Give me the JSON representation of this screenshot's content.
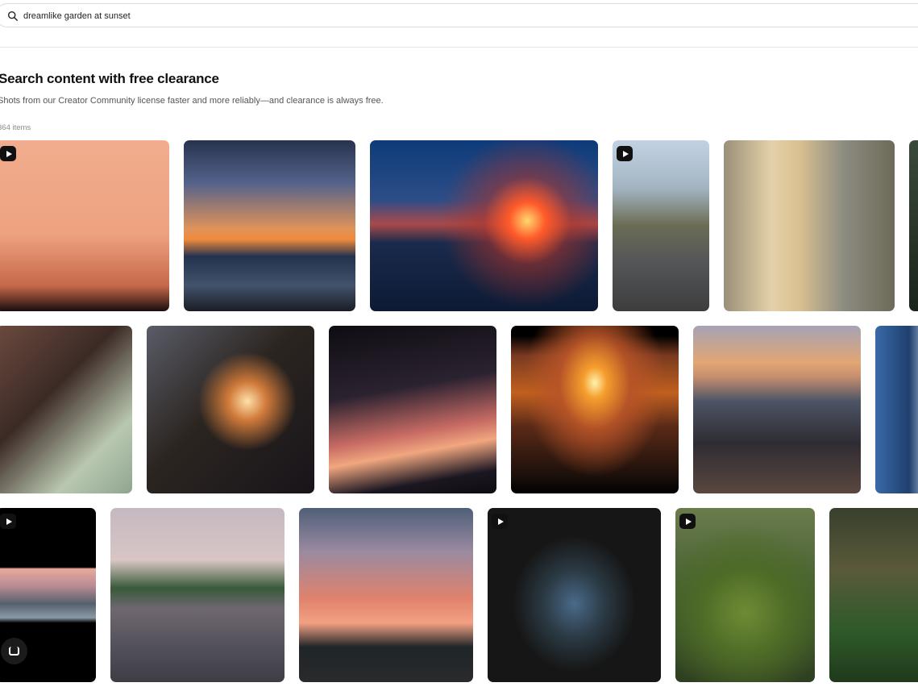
{
  "search": {
    "query": "dreamlike garden at sunset",
    "icon": "search-icon"
  },
  "page": {
    "heading": "Search content with free clearance",
    "subheading": "Shots from our Creator Community license faster and more reliably—and clearance is always free.",
    "count": "364 items"
  },
  "colors": {
    "accent": "#111111",
    "border": "#dcdcdc",
    "muted": "#8a8a8a"
  },
  "tiles": [
    {
      "name": "tile-pink-sky",
      "video": true,
      "bg": "linear-gradient(180deg,#f1ad8e 0%,#eda27f 55%,#c7684a 85%,#1a0e0e 100%)"
    },
    {
      "name": "tile-beach-sunset",
      "video": false,
      "bg": "linear-gradient(180deg,#27334e 0%,#54628a 25%,#e1935a 52%,#f08a3a 58%,#23324e 68%,#42536b 85%,#1a1d25 100%)"
    },
    {
      "name": "tile-airplane-sunset",
      "video": false,
      "bg": "radial-gradient(circle at 69% 47%, #ffd86e 0%, #ff5a2a 10%, rgba(173,52,42,0.55) 24%, rgba(12,39,96,0) 48%), linear-gradient(180deg,#0d3b7a 0%,#2d4d87 35%,#a84a4a 49%,#1a2a4c 60%,#0c1a34 100%)"
    },
    {
      "name": "tile-child-street",
      "video": true,
      "bg": "linear-gradient(180deg,#c2d2e4 0%,#a3b4c1 28%,#6b6c54 50%,#555759 70%,#3d3d3d 100%)"
    },
    {
      "name": "tile-blonde-marina",
      "video": false,
      "bg": "linear-gradient(90deg,#9a8f79 0%,#e5d1a9 28%,#d7bf90 45%,#8d8c81 70%,#6d6a58 100%)"
    },
    {
      "name": "tile-partial-right-1",
      "video": false,
      "bg": "linear-gradient(180deg,#3a4a3a,#1b241b)"
    },
    {
      "name": "tile-portrait-woman",
      "video": false,
      "bg": "linear-gradient(135deg,#6b4a3e 0%,#3c2a26 40%,#b9c8b0 75%,#8fa590 100%)"
    },
    {
      "name": "tile-street-sunflare",
      "video": false,
      "bg": "radial-gradient(circle at 60% 45%, #ffe0a8 0%, #d07a3a 14%, rgba(60,40,30,0) 36%), linear-gradient(135deg,#5a5c68 0%,#2b2520 45%,#18141a 100%)"
    },
    {
      "name": "tile-palm-silhouette",
      "video": false,
      "bg": "linear-gradient(170deg,#0e0d12 0%,#2b2230 38%,#c86b64 62%,#f1a77f 72%,#1b1722 88%,#0d0c10 100%)"
    },
    {
      "name": "tile-mountain-sunset",
      "video": false,
      "bg": "radial-gradient(ellipse at 50% 34%, #fff2b0 0%, #f59e2d 10%, rgba(184,84,40,0.9) 30%, rgba(0,0,0,0) 60%), linear-gradient(180deg,#000 0%,#000 6%,#7a3a20 18%,#c0601e 40%,#5a2a18 60%,#1a0f0a 90%,#000 100%)"
    },
    {
      "name": "tile-couple-pier",
      "video": false,
      "bg": "linear-gradient(180deg,#a6a3b5 0%,#e1a673 22%,#c9906f 30%,#4d5466 45%,#2f2c33 70%,#5a473f 100%)"
    },
    {
      "name": "tile-partial-right-2",
      "video": false,
      "bg": "linear-gradient(90deg,#3a6aa8 0%,#1f3f6e 60%,#c8d6ea 100%)"
    },
    {
      "name": "tile-parking-sunset",
      "video": true,
      "bg": "linear-gradient(180deg,#000 0%,#000 34%,#e8a99d 35%,#b88b94 45%,#55606b 55%,#8a9aa8 63%,#000 66%,#000 100%)"
    },
    {
      "name": "tile-wine-waterway",
      "video": false,
      "bg": "linear-gradient(180deg,#c6b8c2 0%,#d8c6c4 30%,#3a5a3a 46%,#6f6770 58%,#52505a 80%,#3e3c44 100%)"
    },
    {
      "name": "tile-road-sunset",
      "video": false,
      "bg": "linear-gradient(180deg,#4f5f78 0%,#9a8aa0 25%,#e0826d 52%,#f3a082 66%,#1e2528 80%,#2a2a2c 100%)"
    },
    {
      "name": "tile-retro-tv",
      "video": true,
      "bg": "radial-gradient(ellipse at 50% 55%, #4a6a8a 0%, #2b3a44 25%, #161616 50%), linear-gradient(180deg,#1b1b1b,#0e0e0e)"
    },
    {
      "name": "tile-topiary-garden",
      "video": true,
      "bg": "radial-gradient(circle at 50% 60%, #6e8c34 0%, #4e6b27 35%, rgba(30,40,20,0) 70%), linear-gradient(180deg,#6b7c4c 0%,#3f5a2d 55%,#2e3e20 100%)"
    },
    {
      "name": "tile-partial-right-3",
      "video": false,
      "bg": "linear-gradient(180deg,#38402c 0%,#5a5a3a 35%,#2f5a2a 70%,#1f3a1c 100%)"
    }
  ]
}
